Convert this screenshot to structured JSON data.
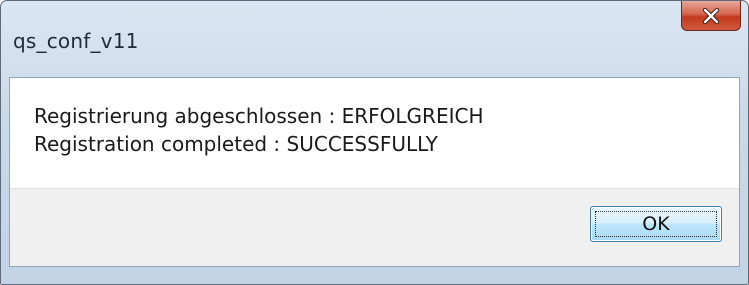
{
  "window": {
    "title": "qs_conf_v11",
    "close_icon": "close-x-icon"
  },
  "message": {
    "line1": "Registrierung abgeschlossen : ERFOLGREICH",
    "line2": "Registration completed : SUCCESSFULLY"
  },
  "buttons": {
    "ok_label": "OK"
  },
  "colors": {
    "close_button": "#c2391f",
    "ok_button_border": "#3c7fb1",
    "title_bar": "#cbdaea"
  }
}
